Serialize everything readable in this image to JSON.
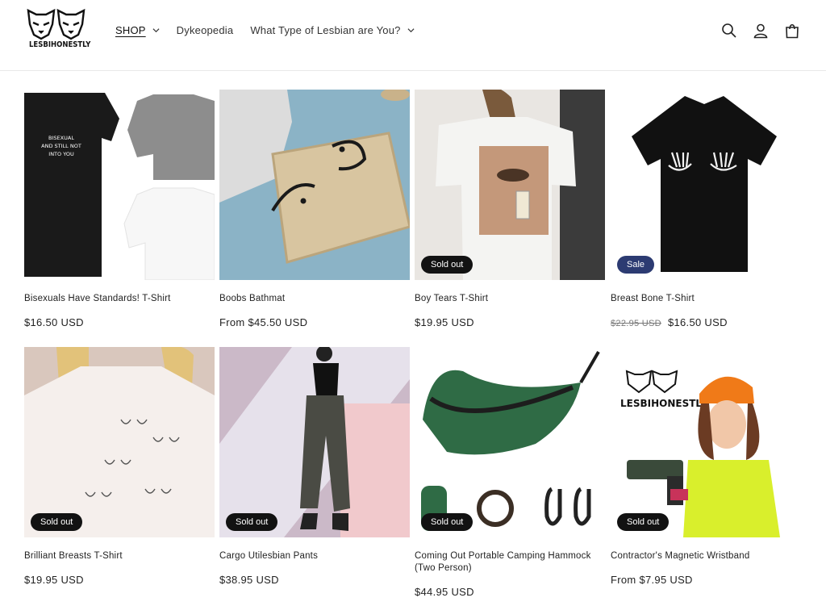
{
  "brand": {
    "name": "LESBIHONESTLY"
  },
  "nav": {
    "items": [
      {
        "label": "SHOP",
        "has_dropdown": true,
        "active": true
      },
      {
        "label": "Dykeopedia",
        "has_dropdown": false,
        "active": false
      },
      {
        "label": "What Type of Lesbian are You?",
        "has_dropdown": true,
        "active": false
      }
    ]
  },
  "header_icons": [
    "search-icon",
    "account-icon",
    "cart-icon"
  ],
  "colors": {
    "sold_out_badge": "#121212",
    "sale_badge": "#2c3b72",
    "text": "#121212",
    "border": "#e8e8e8"
  },
  "products": [
    {
      "title": "Bisexuals Have Standards! T-Shirt",
      "price": "$16.50 USD",
      "old_price": "",
      "badge": "",
      "image": "bisexual-shirts"
    },
    {
      "title": "Boobs Bathmat",
      "price": "From $45.50 USD",
      "old_price": "",
      "badge": "",
      "image": "bathmat"
    },
    {
      "title": "Boy Tears T-Shirt",
      "price": "$19.95 USD",
      "old_price": "",
      "badge": "Sold out",
      "image": "boy-tears-shirt"
    },
    {
      "title": "Breast Bone T-Shirt",
      "price": "$16.50 USD",
      "old_price": "$22.95 USD",
      "badge": "Sale",
      "image": "breast-bone-shirt"
    },
    {
      "title": "Brilliant Breasts T-Shirt",
      "price": "$19.95 USD",
      "old_price": "",
      "badge": "Sold out",
      "image": "brilliant-breasts-shirt"
    },
    {
      "title": "Cargo Utilesbian Pants",
      "price": "$38.95 USD",
      "old_price": "",
      "badge": "Sold out",
      "image": "cargo-pants"
    },
    {
      "title": "Coming Out Portable Camping Hammock (Two Person)",
      "price": "$44.95 USD",
      "old_price": "",
      "badge": "Sold out",
      "image": "hammock"
    },
    {
      "title": "Contractor's Magnetic Wristband",
      "price": "From $7.95 USD",
      "old_price": "",
      "badge": "Sold out",
      "image": "wristband"
    }
  ],
  "image_text": {
    "bisexual_shirt": [
      "BISEXUAL",
      "AND STILL NOT",
      "INTO YOU"
    ],
    "wristband_logo": "LESBIHONESTLY"
  }
}
